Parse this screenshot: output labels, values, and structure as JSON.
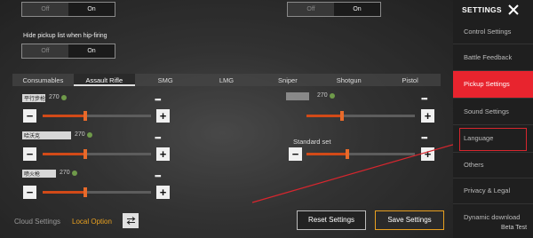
{
  "top_toggles": {
    "left": {
      "off": "Off",
      "on": "On"
    },
    "right": {
      "off": "Off",
      "on": "On"
    }
  },
  "hide_pickup": {
    "label": "Hide pickup list when hip-firing",
    "off": "Off",
    "on": "On"
  },
  "tabs": [
    "Consumables",
    "Assault Rifle",
    "SMG",
    "LMG",
    "Sniper",
    "Shotgun",
    "Pistol"
  ],
  "active_tab": "Assault Rifle",
  "left_weapons": [
    {
      "name": "平行步枪",
      "ammo": "270"
    },
    {
      "name": "哈沃克",
      "ammo": "270"
    },
    {
      "name": "喷火枪",
      "ammo": "270"
    }
  ],
  "right_weapons": [
    {
      "name": "",
      "ammo": "270"
    }
  ],
  "overlay_text": "Standard set",
  "sliders": {
    "fill_fraction_left": 0.5,
    "fill_fraction_right": 0.45
  },
  "footer": {
    "cloud_settings": "Cloud Settings",
    "local_option": "Local Option",
    "reset_settings": "Reset Settings",
    "save_settings": "Save Settings"
  },
  "panel": {
    "title": "SETTINGS",
    "items": [
      "Control Settings",
      "Battle Feedback",
      "Pickup Settings",
      "Sound Settings",
      "Language",
      "Others",
      "Privacy & Legal",
      "Dynamic download"
    ],
    "active_item": "Pickup Settings",
    "beta": "Beta Test"
  },
  "colors": {
    "accent": "#e8242e",
    "slider_fill": "#d24a18",
    "save_border": "#e8a020",
    "highlight_box": "#d8262e"
  }
}
